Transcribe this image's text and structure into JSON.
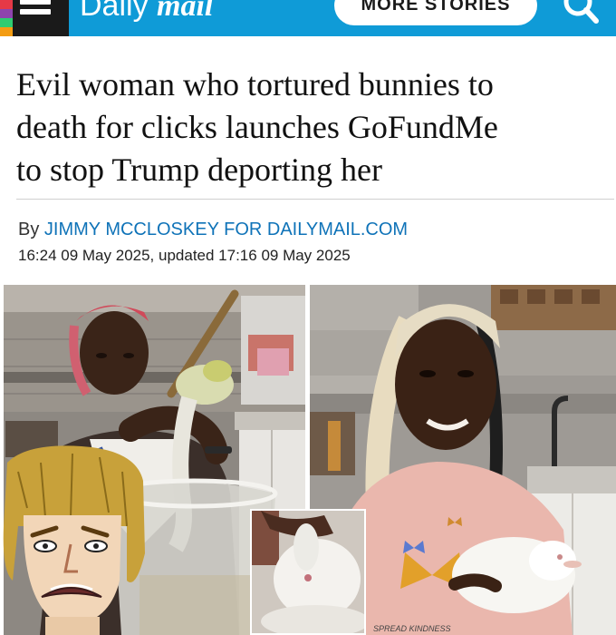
{
  "header": {
    "brand_light": "Daily",
    "brand_bold": "mail",
    "more_stories_label": "MORE STORIES",
    "brand_color": "#0f9bd7"
  },
  "article": {
    "headline_lines": [
      "Evil woman who tortured bunnies to",
      "death for clicks launches GoFundMe",
      "to stop Trump deporting her"
    ],
    "byline_prefix": "By ",
    "author": "JIMMY MCCLOSKEY FOR DAILYMAIL.COM",
    "dateline": "16:24 09 May 2025, updated 17:16 09 May 2025"
  },
  "images": {
    "left_photo": "woman-holding-rabbit-over-bucket-photo",
    "right_photo": "smiling-woman-holding-white-rabbit-photo",
    "inset_photo": "white-rabbit-closeup-photo",
    "overlay": "cartoon-shaggy-disgusted-face",
    "sweatshirt_text": "SPREAD KINDNESS"
  },
  "icons": [
    "menu-icon",
    "search-icon"
  ]
}
